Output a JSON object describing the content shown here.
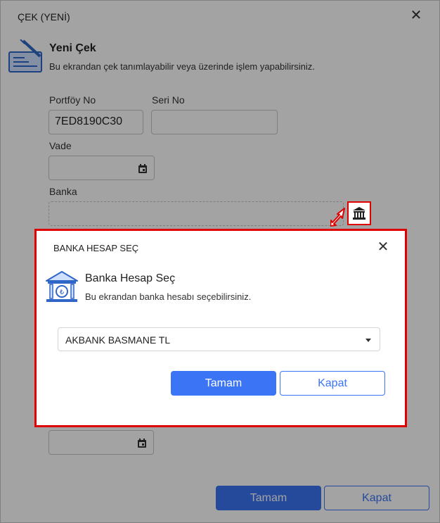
{
  "window": {
    "title": "ÇEK (YENİ)"
  },
  "header": {
    "title": "Yeni Çek",
    "subtitle": "Bu ekrandan çek tanımlayabilir veya üzerinde işlem yapabilirsiniz."
  },
  "form": {
    "portfoy_label": "Portföy No",
    "portfoy_value": "7ED8190C30",
    "seri_label": "Seri No",
    "seri_value": "",
    "vade_label": "Vade",
    "banka_label": "Banka"
  },
  "footer": {
    "ok_label": "Tamam",
    "close_label": "Kapat"
  },
  "modal": {
    "title": "BANKA HESAP SEÇ",
    "header_title": "Banka Hesap Seç",
    "header_subtitle": "Bu ekrandan banka hesabı seçebilirsiniz.",
    "selected_account": "AKBANK BASMANE TL",
    "ok_label": "Tamam",
    "close_label": "Kapat"
  },
  "colors": {
    "primary": "#3b74f5",
    "highlight": "#e00000",
    "icon_blue": "#2f66c8"
  },
  "icons": [
    "close-icon",
    "check-document-icon",
    "calendar-icon",
    "bank-icon",
    "arrow-icon",
    "chevron-down-icon"
  ]
}
